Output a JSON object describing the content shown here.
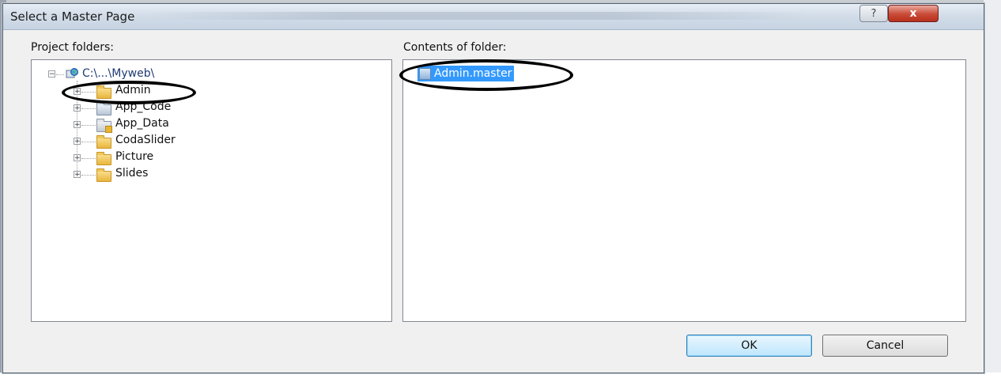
{
  "window": {
    "title": "Select a Master Page",
    "help_label": "?",
    "close_label": "x"
  },
  "project_folders": {
    "label": "Project folders:",
    "root": "C:\\...\\Myweb\\",
    "items": [
      {
        "label": "Admin",
        "icon": "folder-icon"
      },
      {
        "label": "App_Code",
        "icon": "code-folder-icon"
      },
      {
        "label": "App_Data",
        "icon": "data-folder-icon"
      },
      {
        "label": "CodaSlider",
        "icon": "folder-icon"
      },
      {
        "label": "Picture",
        "icon": "folder-icon"
      },
      {
        "label": "Slides",
        "icon": "folder-icon"
      }
    ]
  },
  "contents": {
    "label": "Contents of folder:",
    "files": [
      {
        "label": "Admin.master",
        "selected": true
      }
    ]
  },
  "buttons": {
    "ok": "OK",
    "cancel": "Cancel"
  },
  "colors": {
    "selection": "#3399ff",
    "annotation": "#000000"
  }
}
